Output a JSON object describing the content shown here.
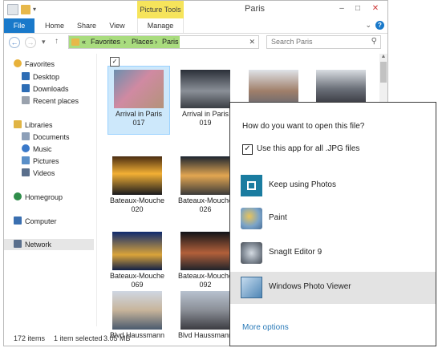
{
  "window": {
    "title": "Paris",
    "context_tab": "Picture Tools",
    "controls": {
      "minimize": "–",
      "maximize": "□",
      "close": "✕"
    }
  },
  "ribbon": {
    "tabs": [
      "File",
      "Home",
      "Share",
      "View",
      "Manage"
    ],
    "help": "?",
    "expand": "⌄"
  },
  "nav": {
    "back": "←",
    "forward": "→",
    "recent": "▾",
    "up": "↑",
    "address_prefix": "«",
    "breadcrumb": [
      "Favorites",
      "Places",
      "Paris"
    ],
    "separator": "›",
    "address_clear": "✕",
    "search_placeholder": "Search Paris",
    "search_icon": "⚲"
  },
  "sidebar": {
    "items": [
      {
        "label": "Favorites",
        "icon": "star-icon",
        "color": "#e8b23a"
      },
      {
        "label": "Desktop",
        "icon": "desktop-icon",
        "color": "#2d6db5"
      },
      {
        "label": "Downloads",
        "icon": "downloads-icon",
        "color": "#2d6db5"
      },
      {
        "label": "Recent places",
        "icon": "recent-places-icon",
        "color": "#9aa2ad"
      },
      {
        "label": "Libraries",
        "icon": "libraries-icon",
        "color": "#e0b444"
      },
      {
        "label": "Documents",
        "icon": "documents-icon",
        "color": "#8c9fb8"
      },
      {
        "label": "Music",
        "icon": "music-icon",
        "color": "#3a79c9"
      },
      {
        "label": "Pictures",
        "icon": "pictures-icon",
        "color": "#5a8fc8"
      },
      {
        "label": "Videos",
        "icon": "videos-icon",
        "color": "#5a6f8c"
      },
      {
        "label": "Homegroup",
        "icon": "homegroup-icon",
        "color": "#2f8d4a"
      },
      {
        "label": "Computer",
        "icon": "computer-icon",
        "color": "#3a6fb0"
      },
      {
        "label": "Network",
        "icon": "network-icon",
        "color": "#5a6f8c"
      }
    ]
  },
  "files": [
    {
      "name": "Arrival in Paris",
      "num": "017",
      "selected": true,
      "colors": [
        "#6d8fae",
        "#d08aa2",
        "#b3937a"
      ]
    },
    {
      "name": "Arrival in Paris",
      "num": "019",
      "colors": [
        "#2a2f38",
        "#8a8f97",
        "#3a3e44"
      ]
    },
    {
      "name": "",
      "num": "",
      "colors": [
        "#a07f6a",
        "#dfe3e8",
        "#5d6470"
      ]
    },
    {
      "name": "",
      "num": "",
      "colors": [
        "#d9dde2",
        "#2a2a30",
        "#6a6f78"
      ]
    },
    {
      "name": "Bateaux-Mouche",
      "num": "020",
      "colors": [
        "#1a1a1e",
        "#f3b034",
        "#4a2d12"
      ]
    },
    {
      "name": "Bateaux-Mouche",
      "num": "026",
      "colors": [
        "#1c2430",
        "#e2a651",
        "#3a3a3a"
      ]
    },
    {
      "name": "Bateaux-Mouche",
      "num": "069",
      "colors": [
        "#0f2a6e",
        "#d9a33a",
        "#122046"
      ]
    },
    {
      "name": "Bateaux-Mouche",
      "num": "092",
      "colors": [
        "#101318",
        "#b2603a",
        "#20232a"
      ]
    },
    {
      "name": "Blvd Haussmann",
      "num": "",
      "colors": [
        "#cfd7e2",
        "#4a5a6e",
        "#c7b49a"
      ]
    },
    {
      "name": "Blvd Haussmann",
      "num": "",
      "colors": [
        "#b8c2cf",
        "#3c3c42",
        "#8a8e96"
      ]
    }
  ],
  "status": {
    "count": "172 items",
    "selection": "1 item selected",
    "size": "3.05 MB"
  },
  "dialog": {
    "question": "How do you want to open this file?",
    "checkbox_label": "Use this app for all .JPG files",
    "checkbox_mark": "✓",
    "apps": [
      {
        "label": "Keep using Photos",
        "icon": "photos-icon",
        "color": "#1a7ca0"
      },
      {
        "label": "Paint",
        "icon": "paint-icon",
        "color": "#7aa3c8"
      },
      {
        "label": "SnagIt Editor 9",
        "icon": "snagit-icon",
        "color": "#7c8590"
      },
      {
        "label": "Windows Photo Viewer",
        "icon": "photo-viewer-icon",
        "color": "#4f86b5",
        "highlighted": true
      }
    ],
    "more_options": "More options"
  }
}
